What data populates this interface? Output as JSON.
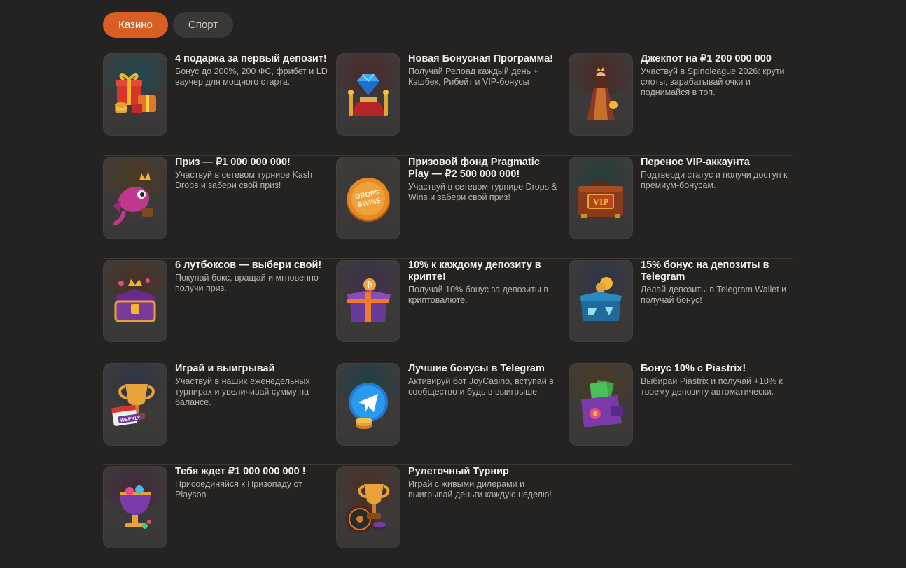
{
  "tabs": {
    "casino": "Казино",
    "sport": "Спорт"
  },
  "promos": [
    {
      "title": "4 подарка за первый депозит!",
      "desc": "Бонус до 200%, 200 ФС, фрибет и LD ваучер для мощного старта.",
      "icon": "gift-boxes-icon",
      "glow": "#1f4850"
    },
    {
      "title": "Новая Бонусная Программа!",
      "desc": "Получай Релоад каждый день + Кэшбек, Рибейт и VIP-бонусы",
      "icon": "diamond-pedestal-icon",
      "glow": "#4a2a2a"
    },
    {
      "title": "Джекпот на ₽1 200 000 000",
      "desc": "Участвуй в Spinoleague 2026: крути слоты, зарабатывай очки и поднимайся в топ.",
      "icon": "queen-figure-icon",
      "glow": "#4a2a26"
    },
    {
      "title": "Приз — ₽1 000 000 000!",
      "desc": "Участвуй в сетевом турнире Kash Drops и забери свой приз!",
      "icon": "crowned-fish-icon",
      "glow": "#4a3a22"
    },
    {
      "title": "Призовой фонд Pragmatic Play — ₽2 500 000 000!",
      "desc": "Участвуй в сетевом турнире Drops & Wins и забери свой приз!",
      "icon": "drops-wins-coin-icon",
      "glow": "#3a3836",
      "coin_text": "DROPS &WINS"
    },
    {
      "title": "Перенос VIP-аккаунта",
      "desc": "Подтверди статус и получи доступ к премиум-бонусам.",
      "icon": "vip-suitcase-icon",
      "glow": "#253e3a",
      "vip_text": "VIP"
    },
    {
      "title": "6 лутбоксов — выбери свой!",
      "desc": "Покупай бокс, вращай и мгновенно получи приз.",
      "icon": "treasure-chest-icon",
      "glow": "#4a3222"
    },
    {
      "title": "10% к каждому депозиту в крипте!",
      "desc": "Получай 10% бонус за депозиты в криптовалюте.",
      "icon": "crypto-gift-icon",
      "glow": "#3e2f4a"
    },
    {
      "title": "15% бонус на депозиты в Telegram",
      "desc": "Делай депозиты в Telegram Wallet и получай бонус!",
      "icon": "telegram-box-icon",
      "glow": "#2e3548"
    },
    {
      "title": "Играй и выигрывай",
      "desc": "Участвуй в наших еженедельных турнирах и увеличивай сумму на балансе.",
      "icon": "weekly-trophy-icon",
      "glow": "#2e3548",
      "badge_text": "WEEKLY"
    },
    {
      "title": "Лучшие бонусы в Telegram",
      "desc": "Активируй бот JoyCasino, вступай в сообщество и будь в выигрыше",
      "icon": "telegram-coin-icon",
      "glow": "#1f4048"
    },
    {
      "title": "Бонус 10% с Piastrix!",
      "desc": "Выбирай Piastrix и получай +10% к твоему депозиту автоматически.",
      "icon": "wallet-icon",
      "glow": "#4a3a22"
    },
    {
      "title": "Тебя ждет ₽1 000 000 000 !",
      "desc": "Присоединяйся к Призопаду от Playson",
      "icon": "gem-goblet-icon",
      "glow": "#42283e"
    },
    {
      "title": "Рулеточный Турнир",
      "desc": "Играй с живыми дилерами и выигрывай деньги каждую неделю!",
      "icon": "roulette-trophy-icon",
      "glow": "#4a3026"
    }
  ]
}
